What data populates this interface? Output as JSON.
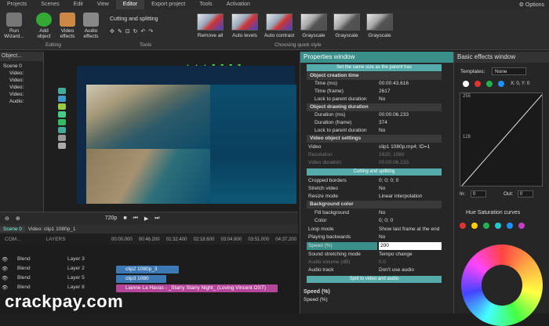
{
  "menu": {
    "items": [
      "Projects",
      "Scenes",
      "Edit",
      "View",
      "Editor",
      "Export project",
      "Tools",
      "Activation"
    ],
    "options_label": "Options"
  },
  "ribbon": {
    "run_wizard": "Run Wizard...",
    "add_object": "Add object",
    "video_effects": "Video effects",
    "audio_effects": "Audio effects",
    "editing_group": "Editing",
    "cutting_label": "Cutting and splitting",
    "tools_group": "Tools",
    "quick_styles": [
      "Remove all",
      "Auto levels",
      "Auto contrast",
      "Grayscale",
      "Grayscale",
      "Grayscale"
    ],
    "quick_group": "Choosing quick style"
  },
  "objects": {
    "title": "Object...",
    "scene": "Scene 0",
    "items": [
      "Video:",
      "Video:",
      "Video:",
      "Video:",
      "Audio:"
    ]
  },
  "playback": {
    "zoom": "720p"
  },
  "timeline": {
    "tabs": [
      "Scene 0",
      "Video: clip1 1080p_1"
    ],
    "ruler": [
      "00:00.000",
      "00:46.200",
      "01:32.400",
      "02:18.600",
      "03:04.800",
      "03:51.000",
      "04:37.200"
    ],
    "header_label": "COM...",
    "layers_label": "LAYERS",
    "rows": [
      {
        "blend": "Blend",
        "layer": "Layer 3"
      },
      {
        "blend": "Blend",
        "layer": "Layer 2"
      },
      {
        "blend": "Blend",
        "layer": "Layer 5"
      },
      {
        "blend": "Blend",
        "layer": "Layer 8"
      }
    ],
    "clips": [
      "clip2 1080p_3",
      "clip3 1080",
      "Lianne La Havas - _Starry Starry Night_ (Loving Vincent OST)"
    ]
  },
  "properties": {
    "title": "Properties window",
    "parent_bar": "Set the same size as the parent has",
    "creation_section": "Object creation time",
    "time_ms": {
      "k": "Time (ms)",
      "v": "00:00:43.616"
    },
    "time_frame": {
      "k": "Time (frame)",
      "v": "2617"
    },
    "lock1": {
      "k": "Lock to parent duration",
      "v": "No"
    },
    "drawing_section": "Object drawing duration",
    "dur_ms": {
      "k": "Duration (ms)",
      "v": "00:00:06.233"
    },
    "dur_frame": {
      "k": "Duration (frame)",
      "v": "374"
    },
    "lock2": {
      "k": "Lock to parent duration",
      "v": "No"
    },
    "video_section": "Video object settings",
    "video": {
      "k": "Video",
      "v": "clip1 1080p.mp4; ID=1"
    },
    "resolution": {
      "k": "Resolution",
      "v": "1920; 1080"
    },
    "video_duration": {
      "k": "Video duration",
      "v": "00:00:06.233"
    },
    "cut_bar": "Cutting and splitting",
    "cropped": {
      "k": "Cropped borders",
      "v": "0; 0; 0; 0"
    },
    "stretch": {
      "k": "Stretch video",
      "v": "No"
    },
    "resize": {
      "k": "Resize mode",
      "v": "Linear interpolation"
    },
    "bg_section": "Background color",
    "fill": {
      "k": "Fill background",
      "v": "No"
    },
    "color": {
      "k": "Color",
      "v": "0; 0; 0"
    },
    "loop": {
      "k": "Loop mode",
      "v": "Show last frame at the end"
    },
    "backwards": {
      "k": "Playing backwards",
      "v": "No"
    },
    "speed": {
      "k": "Speed (%)",
      "v": "200"
    },
    "stretching": {
      "k": "Sound stretching mode",
      "v": "Tempo change"
    },
    "audio_volume": {
      "k": "Audio volume (dB)",
      "v": "0.0"
    },
    "audio_track": {
      "k": "Audio track",
      "v": "Don't use audio"
    },
    "split_bar": "Split to video and audio",
    "footer_title": "Speed (%)",
    "footer_desc": "Speed (%)"
  },
  "effects": {
    "title": "Basic effects window",
    "templates_label": "Templates:",
    "templates_value": "None",
    "xy": "X: 0, Y: 0",
    "axis_top": "255",
    "axis_mid": "128",
    "in_label": "In:",
    "out_label": "Out:",
    "in_val": "0",
    "out_val": "0",
    "hue_title": "Hue Saturation curves",
    "dot_colors": [
      "#ffffff",
      "#e03333",
      "#22b14c",
      "#1e90ff"
    ],
    "hue_dots": [
      "#e03333",
      "#ffcc00",
      "#22b14c",
      "#1ecbcb",
      "#1e90ff",
      "#c040c0"
    ]
  },
  "watermark": "crackpay.com"
}
